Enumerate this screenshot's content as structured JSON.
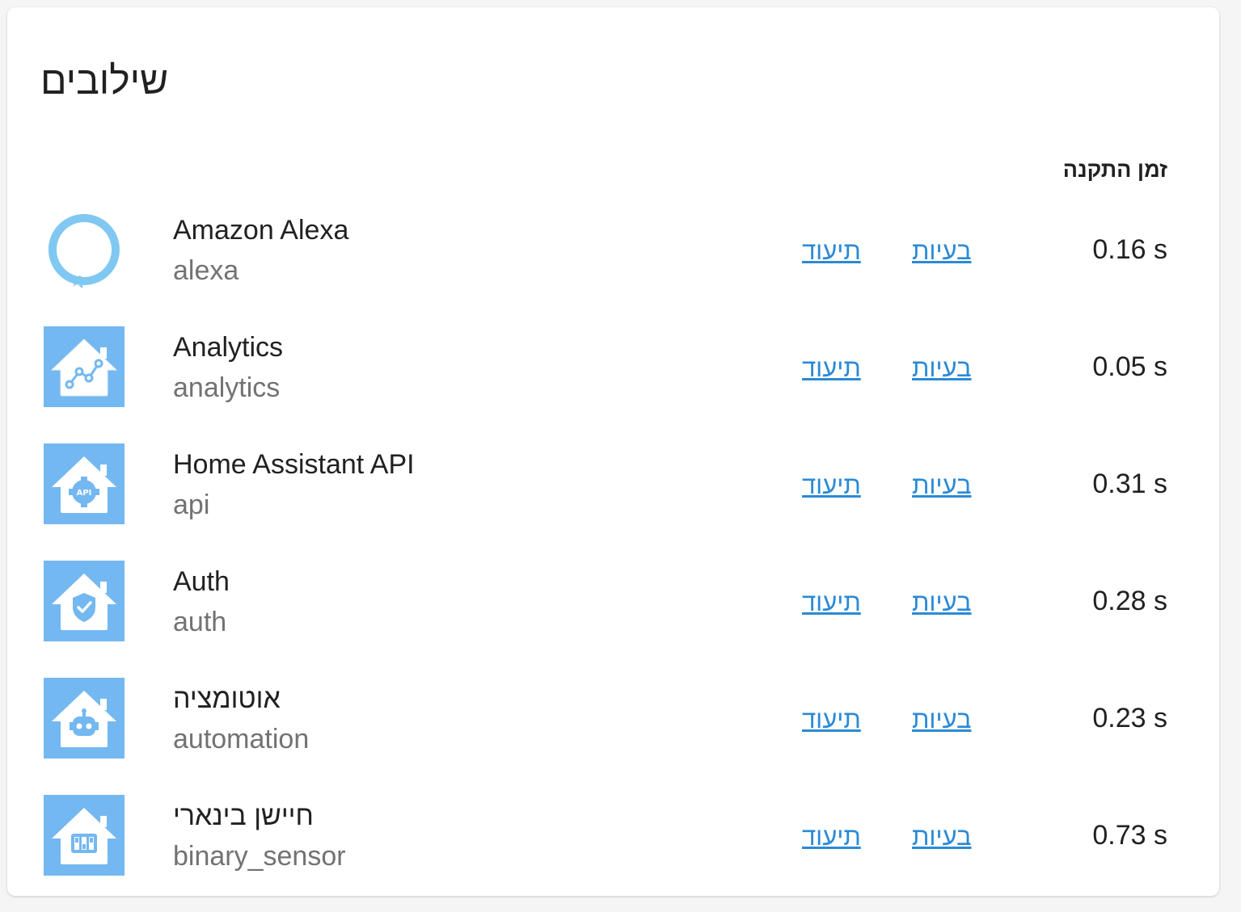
{
  "page": {
    "title": "שילובים",
    "column_header": "זמן התקנה"
  },
  "colors": {
    "icon_background": "#74b8f1",
    "link": "#2b8ad6",
    "alexa_ring": "#80c8f2"
  },
  "integrations": [
    {
      "name": "Amazon Alexa",
      "domain": "alexa",
      "docs_label": "תיעוד",
      "issues_label": "בעיות",
      "setup_time": "0.16 s",
      "icon": "alexa-icon"
    },
    {
      "name": "Analytics",
      "domain": "analytics",
      "docs_label": "תיעוד",
      "issues_label": "בעיות",
      "setup_time": "0.05 s",
      "icon": "analytics-icon"
    },
    {
      "name": "Home Assistant API",
      "domain": "api",
      "docs_label": "תיעוד",
      "issues_label": "בעיות",
      "setup_time": "0.31 s",
      "icon": "api-icon",
      "icon_text": "API"
    },
    {
      "name": "Auth",
      "domain": "auth",
      "docs_label": "תיעוד",
      "issues_label": "בעיות",
      "setup_time": "0.28 s",
      "icon": "auth-shield-icon"
    },
    {
      "name": "אוטומציה",
      "domain": "automation",
      "docs_label": "תיעוד",
      "issues_label": "בעיות",
      "setup_time": "0.23 s",
      "icon": "automation-robot-icon"
    },
    {
      "name": "חיישן בינארי",
      "domain": "binary_sensor",
      "docs_label": "תיעוד",
      "issues_label": "בעיות",
      "setup_time": "0.73 s",
      "icon": "binary-sensor-icon"
    }
  ]
}
